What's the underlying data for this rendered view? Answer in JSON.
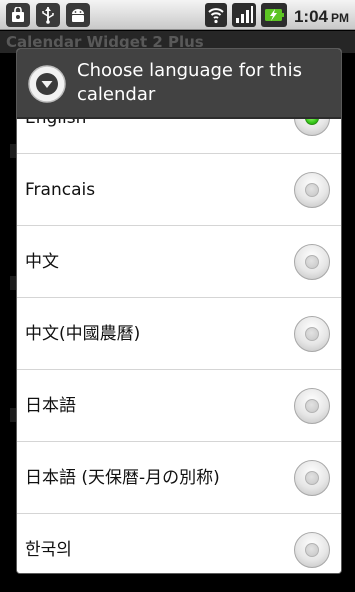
{
  "status_bar": {
    "time": "1:04",
    "ampm": "PM",
    "left_icons": [
      "shopping-bag-icon",
      "usb-icon",
      "android-debug-icon"
    ],
    "right_icons": [
      "wifi-icon",
      "signal-icon",
      "battery-charging-icon"
    ]
  },
  "background_app": {
    "title": "Calendar Widget 2 Plus"
  },
  "dialog": {
    "title": "Choose language for this calendar",
    "icon": "dropdown-circle-icon",
    "options": [
      {
        "label": "English",
        "selected": true
      },
      {
        "label": "Francais",
        "selected": false
      },
      {
        "label": "中文",
        "selected": false
      },
      {
        "label": "中文(中國農曆)",
        "selected": false
      },
      {
        "label": "日本語",
        "selected": false
      },
      {
        "label": "日本語 (天保暦-月の別称)",
        "selected": false
      },
      {
        "label": "한국의",
        "selected": false
      }
    ]
  },
  "colors": {
    "accent_selected": "#3ccc1a",
    "dialog_header": "#424242"
  }
}
